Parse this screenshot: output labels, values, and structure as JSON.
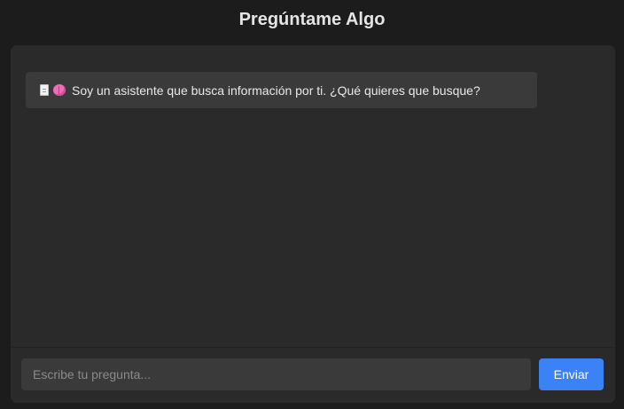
{
  "app": {
    "title": "Pregúntame Algo"
  },
  "chat": {
    "messages": [
      {
        "icons": [
          "document-icon",
          "brain-icon"
        ],
        "text": "Soy un asistente que busca información por ti. ¿Qué quieres que busque?"
      }
    ]
  },
  "composer": {
    "placeholder": "Escribe tu pregunta...",
    "value": "",
    "send_label": "Enviar"
  },
  "colors": {
    "background": "#1c1c1c",
    "panel": "#2a2a2a",
    "bubble": "#3a3a3a",
    "accent": "#3b82f6"
  }
}
